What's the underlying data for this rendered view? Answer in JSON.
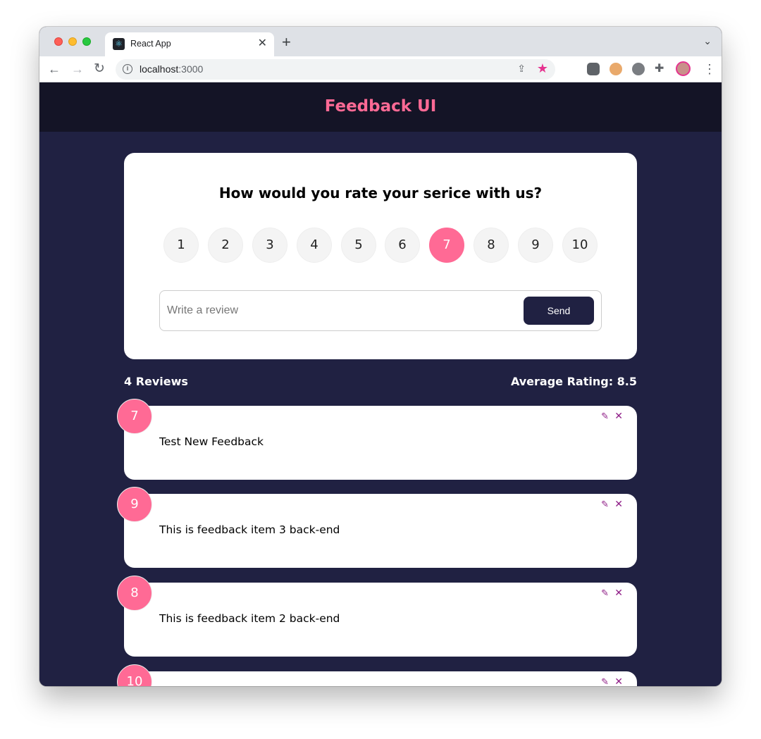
{
  "browser": {
    "tab_title": "React App",
    "tab_favicon_icon": "react-logo-icon",
    "url_host": "localhost",
    "url_port": ":3000"
  },
  "app": {
    "title": "Feedback UI",
    "accent_color": "#ff6a95",
    "background_color": "#202142"
  },
  "rating_form": {
    "question": "How would you rate your serice with us?",
    "options": [
      "1",
      "2",
      "3",
      "4",
      "5",
      "6",
      "7",
      "8",
      "9",
      "10"
    ],
    "selected": "7",
    "input_placeholder": "Write a review",
    "send_label": "Send"
  },
  "stats": {
    "count_label": "4 Reviews",
    "average_label": "Average Rating: 8.5"
  },
  "feedback": [
    {
      "rating": "7",
      "text": "Test New Feedback"
    },
    {
      "rating": "9",
      "text": "This is feedback item 3 back-end"
    },
    {
      "rating": "8",
      "text": "This is feedback item 2 back-end"
    },
    {
      "rating": "10",
      "text": ""
    }
  ]
}
